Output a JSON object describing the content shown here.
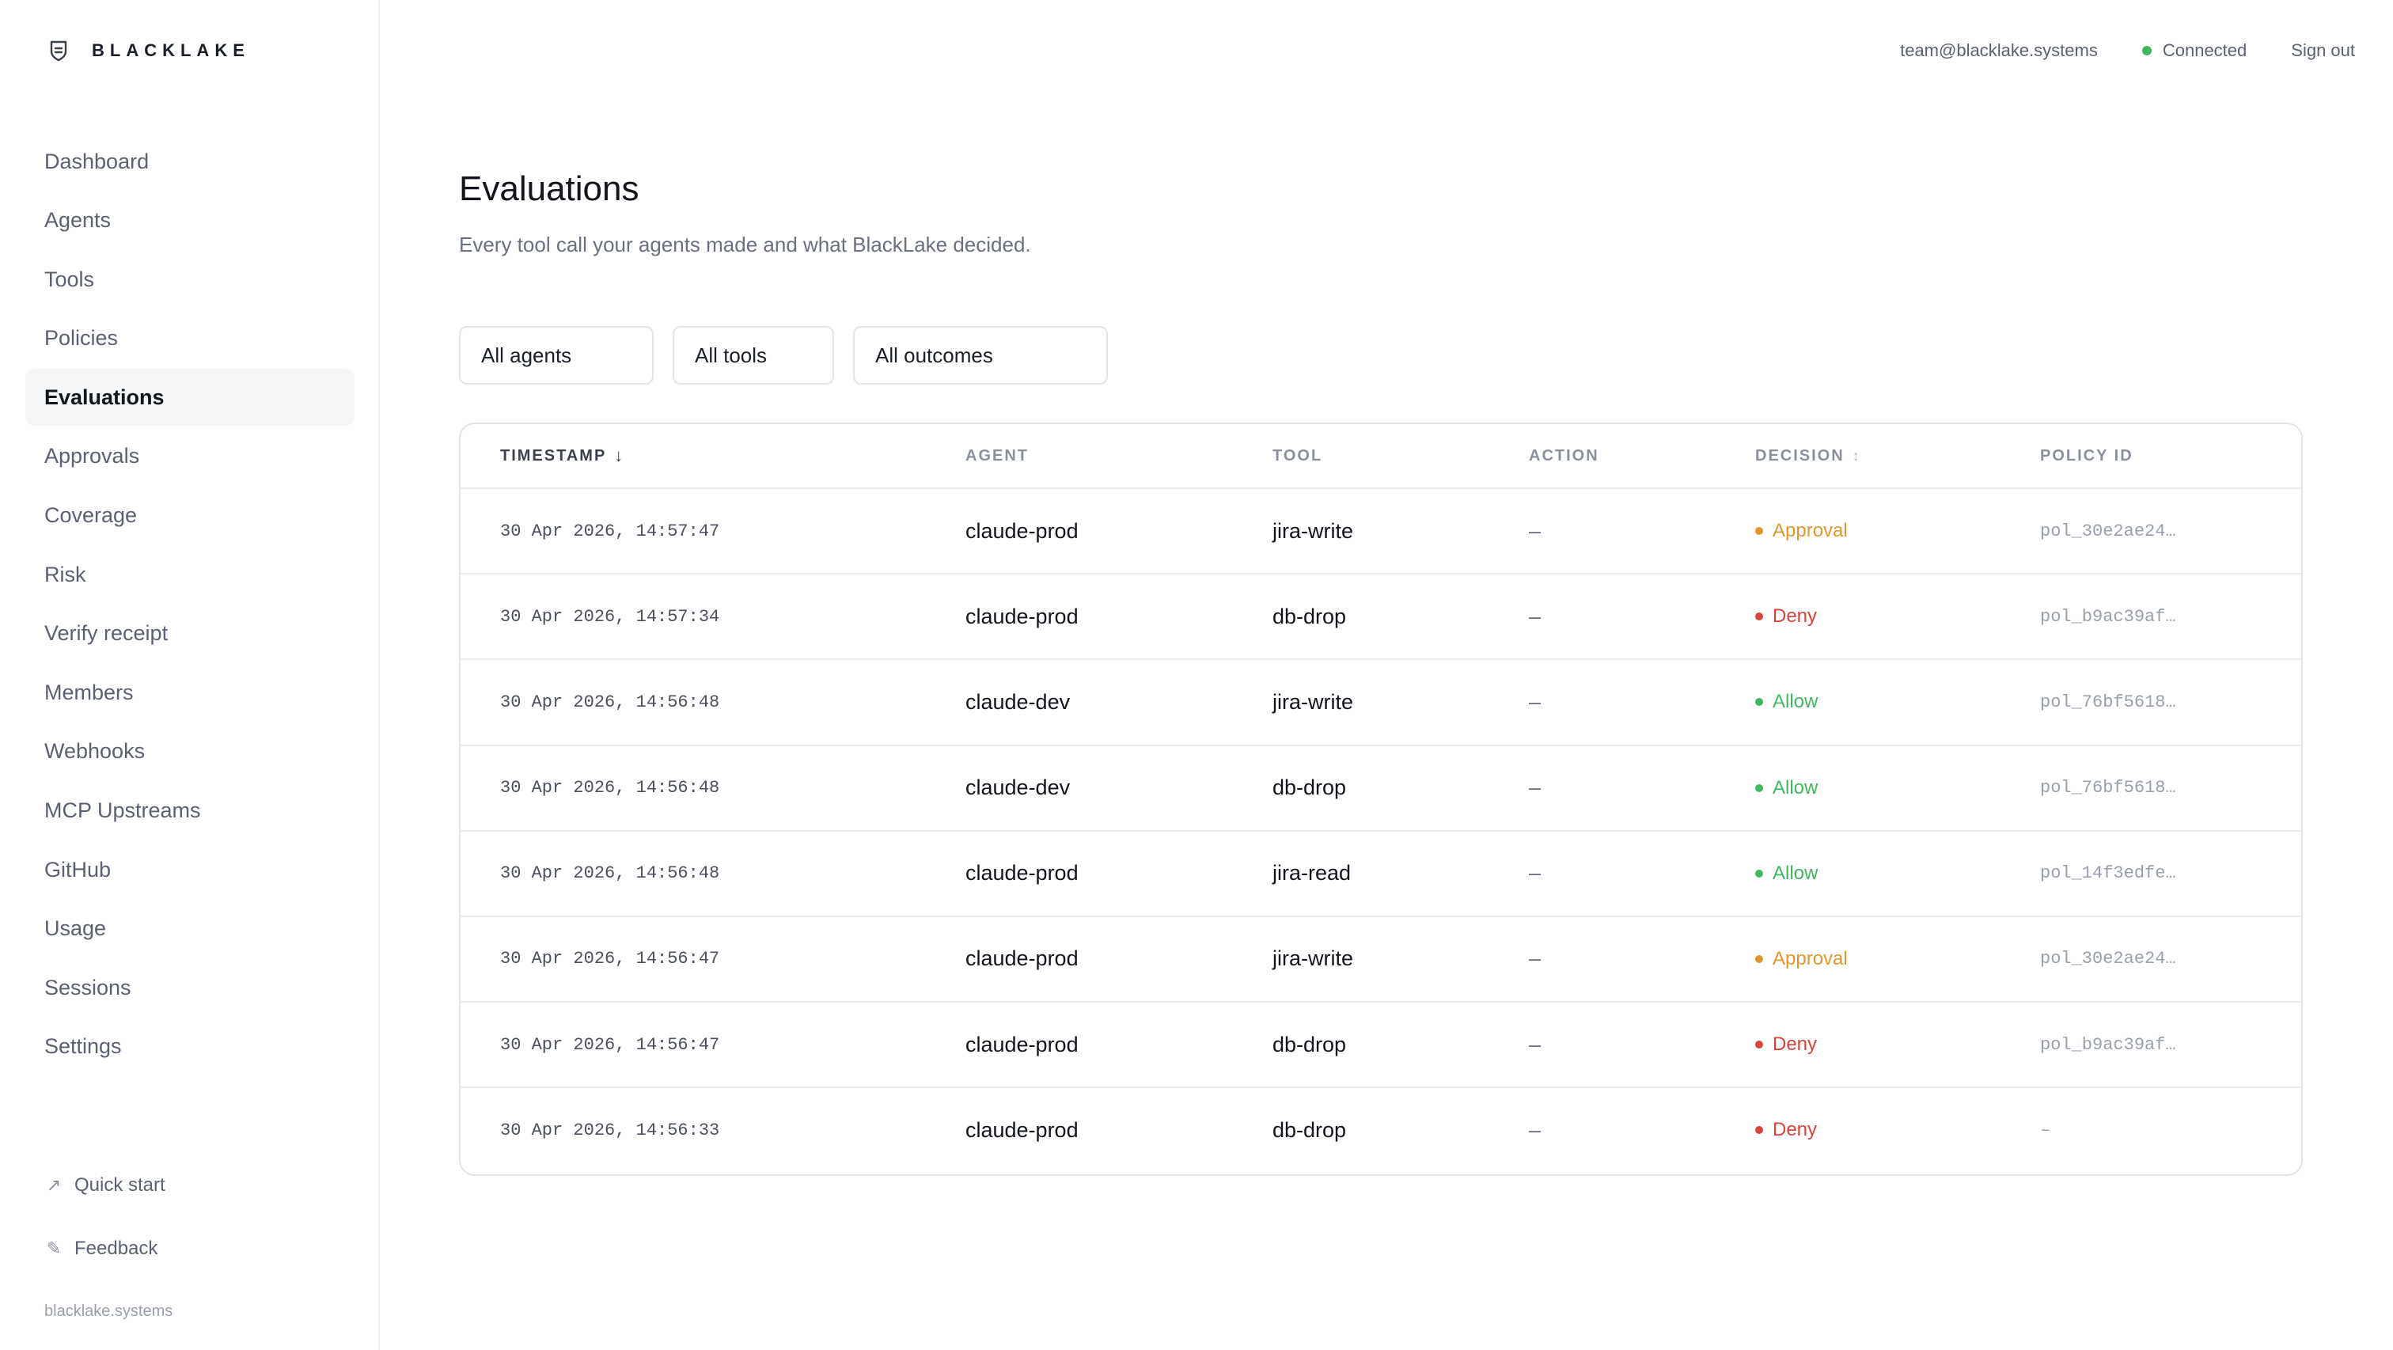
{
  "brand": {
    "name": "BLACKLAKE",
    "icon": "shield-icon"
  },
  "topbar": {
    "email": "team@blacklake.systems",
    "status": "Connected",
    "status_color": "#3fb95f",
    "signout": "Sign out"
  },
  "sidebar": {
    "items": [
      {
        "label": "Dashboard"
      },
      {
        "label": "Agents"
      },
      {
        "label": "Tools"
      },
      {
        "label": "Policies"
      },
      {
        "label": "Evaluations",
        "active": true
      },
      {
        "label": "Approvals"
      },
      {
        "label": "Coverage"
      },
      {
        "label": "Risk"
      },
      {
        "label": "Verify receipt"
      },
      {
        "label": "Members"
      },
      {
        "label": "Webhooks"
      },
      {
        "label": "MCP Upstreams"
      },
      {
        "label": "GitHub"
      },
      {
        "label": "Usage"
      },
      {
        "label": "Sessions"
      },
      {
        "label": "Settings"
      }
    ],
    "quick_start": "Quick start",
    "feedback": "Feedback",
    "footer": "blacklake.systems"
  },
  "page": {
    "title": "Evaluations",
    "subtitle": "Every tool call your agents made and what BlackLake decided."
  },
  "filters": {
    "agents": "All agents",
    "tools": "All tools",
    "outcomes": "All outcomes"
  },
  "table": {
    "columns": {
      "timestamp": "TIMESTAMP",
      "timestamp_sort": "↓",
      "agent": "AGENT",
      "tool": "TOOL",
      "action": "ACTION",
      "decision": "DECISION",
      "decision_sort": "↕",
      "policy": "POLICY ID"
    },
    "rows": [
      {
        "timestamp": "30 Apr 2026, 14:57:47",
        "agent": "claude-prod",
        "tool": "jira-write",
        "action": "–",
        "decision": "Approval",
        "policy": "pol_30e2ae24…"
      },
      {
        "timestamp": "30 Apr 2026, 14:57:34",
        "agent": "claude-prod",
        "tool": "db-drop",
        "action": "–",
        "decision": "Deny",
        "policy": "pol_b9ac39af…"
      },
      {
        "timestamp": "30 Apr 2026, 14:56:48",
        "agent": "claude-dev",
        "tool": "jira-write",
        "action": "–",
        "decision": "Allow",
        "policy": "pol_76bf5618…"
      },
      {
        "timestamp": "30 Apr 2026, 14:56:48",
        "agent": "claude-dev",
        "tool": "db-drop",
        "action": "–",
        "decision": "Allow",
        "policy": "pol_76bf5618…"
      },
      {
        "timestamp": "30 Apr 2026, 14:56:48",
        "agent": "claude-prod",
        "tool": "jira-read",
        "action": "–",
        "decision": "Allow",
        "policy": "pol_14f3edfe…"
      },
      {
        "timestamp": "30 Apr 2026, 14:56:47",
        "agent": "claude-prod",
        "tool": "jira-write",
        "action": "–",
        "decision": "Approval",
        "policy": "pol_30e2ae24…"
      },
      {
        "timestamp": "30 Apr 2026, 14:56:47",
        "agent": "claude-prod",
        "tool": "db-drop",
        "action": "–",
        "decision": "Deny",
        "policy": "pol_b9ac39af…"
      },
      {
        "timestamp": "30 Apr 2026, 14:56:33",
        "agent": "claude-prod",
        "tool": "db-drop",
        "action": "–",
        "decision": "Deny",
        "policy": "–"
      }
    ]
  },
  "decision_colors": {
    "Approval": "#e0982b",
    "Deny": "#d8433b",
    "Allow": "#3fb95f"
  }
}
